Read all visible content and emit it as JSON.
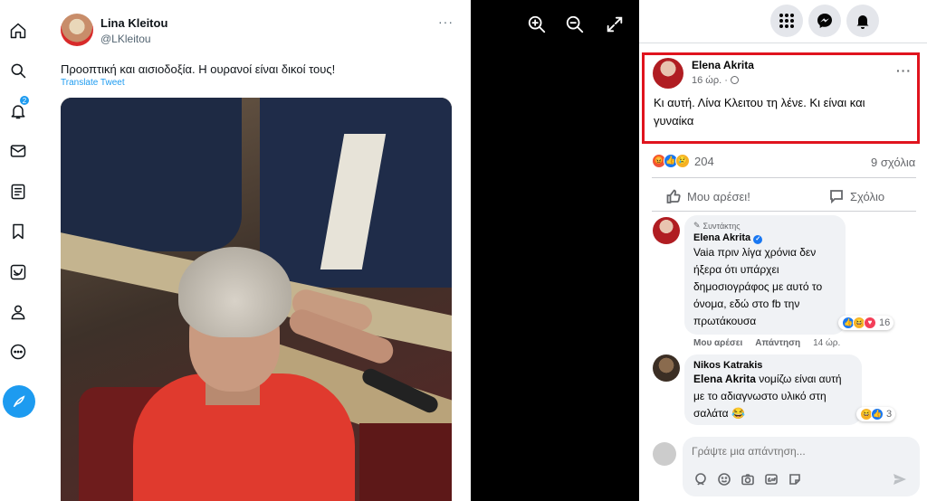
{
  "twitter": {
    "nav_badge": "2",
    "name": "Lina Kleitou",
    "handle": "@LKleitou",
    "tweet_text": "Προοπτική και αισιοδοξία. Η ουρανοί είναι δικοί τους!",
    "translate_label": "Translate Tweet",
    "more_label": "···",
    "nav_icons": [
      "home-icon",
      "search-icon",
      "bell-icon",
      "mail-icon",
      "list-icon",
      "bookmark-icon",
      "twitter-blue-icon",
      "profile-icon",
      "more-circle-icon"
    ],
    "accent_color": "#1d9bf0"
  },
  "viewer": {
    "controls": [
      "zoom-in-icon",
      "zoom-out-icon",
      "expand-icon"
    ]
  },
  "facebook": {
    "top_buttons": [
      "menu-grid-icon",
      "messenger-icon",
      "notifications-icon"
    ],
    "post": {
      "author": "Elena Akrita",
      "time": "16 ώρ. · ",
      "text": "Κι αυτή. Λίνα Κλειτου τη λένε. Κι είναι και γυναίκα",
      "more_label": "···",
      "reactions_count": "204",
      "comments_count": "9 σχόλια",
      "like_label": "Μου αρέσει!",
      "comment_label": "Σχόλιο"
    },
    "comments": [
      {
        "badge": "Συντάκτης",
        "author": "Elena Akrita",
        "text": "Vaia πριν λίγα χρόνια δεν ήξερα ότι υπάρχει δημοσιογράφος με αυτό το όνομα, εδώ στο fb την πρωτάκουσα",
        "reactions": "16",
        "like_label": "Μου αρέσει",
        "reply_label": "Απάντηση",
        "time": "14 ώρ."
      },
      {
        "author": "Nikos Katrakis",
        "mention": "Elena Akrita",
        "text": " νομίζω είναι αυτή με το αδιαγνωστο υλικό στη σαλάτα 😂",
        "reactions": "3"
      }
    ],
    "reply_placeholder": "Γράψτε μια απάντηση...",
    "highlight_color": "#e0141e"
  }
}
